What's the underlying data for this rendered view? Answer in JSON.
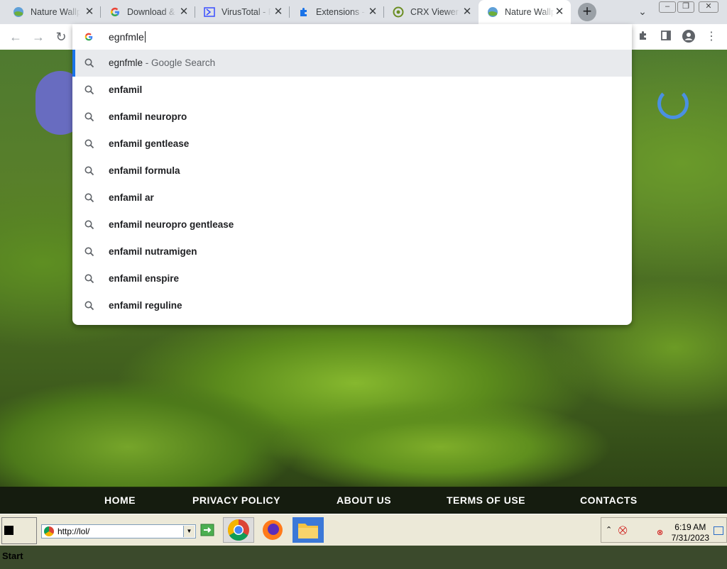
{
  "tabs": [
    {
      "title": "Nature Wallpapers",
      "favicon": "globe-icon"
    },
    {
      "title": "Download & Install",
      "favicon": "google-icon"
    },
    {
      "title": "VirusTotal - File",
      "favicon": "virustotal-icon"
    },
    {
      "title": "Extensions - Manage",
      "favicon": "puzzle-icon"
    },
    {
      "title": "CRX Viewer",
      "favicon": "crx-icon"
    },
    {
      "title": "Nature Wallpapers",
      "favicon": "globe-icon",
      "active": true
    }
  ],
  "omnibox": {
    "value": "egnfmle",
    "suggestions": [
      {
        "text": "egnfmle",
        "suffix": " - Google Search",
        "selected": true
      },
      {
        "text": "enfamil"
      },
      {
        "text": "enfamil neuropro"
      },
      {
        "text": "enfamil gentlease"
      },
      {
        "text": "enfamil formula"
      },
      {
        "text": "enfamil ar"
      },
      {
        "text": "enfamil neuropro gentlease"
      },
      {
        "text": "enfamil nutramigen"
      },
      {
        "text": "enfamil enspire"
      },
      {
        "text": "enfamil reguline"
      }
    ]
  },
  "footer": {
    "home": "HOME",
    "privacy": "PRIVACY POLICY",
    "about": "ABOUT US",
    "terms": "TERMS OF USE",
    "contacts": "CONTACTS"
  },
  "taskbar": {
    "start_label": "Start",
    "address": "http://lol/",
    "time": "6:19 AM",
    "date": "7/31/2023"
  },
  "colors": {
    "accent": "#1a73e8",
    "tabstrip": "#dee1e6",
    "selected_row": "#e8eaed"
  }
}
